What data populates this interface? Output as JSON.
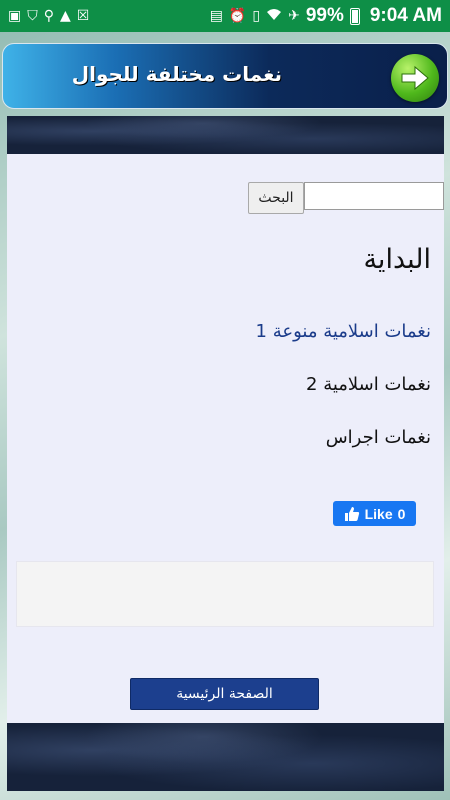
{
  "status_bar": {
    "battery": "99%",
    "time": "9:04 AM"
  },
  "header": {
    "title": "نغمات مختلفة للجوال"
  },
  "search": {
    "button_label": "البحث",
    "value": "",
    "placeholder": ""
  },
  "page_title": "البداية",
  "menu": {
    "items": [
      {
        "label": "نغمات اسلامية منوعة 1"
      },
      {
        "label": "نغمات اسلامية 2"
      },
      {
        "label": "نغمات اجراس"
      }
    ]
  },
  "like": {
    "label": "Like",
    "count": "0"
  },
  "footer": {
    "home_label": "الصفحة الرئيسية"
  },
  "colors": {
    "status_bar": "#0e8f47",
    "link": "#1a3b8a",
    "home_button": "#1c3f8e",
    "like_button": "#1877f2"
  }
}
